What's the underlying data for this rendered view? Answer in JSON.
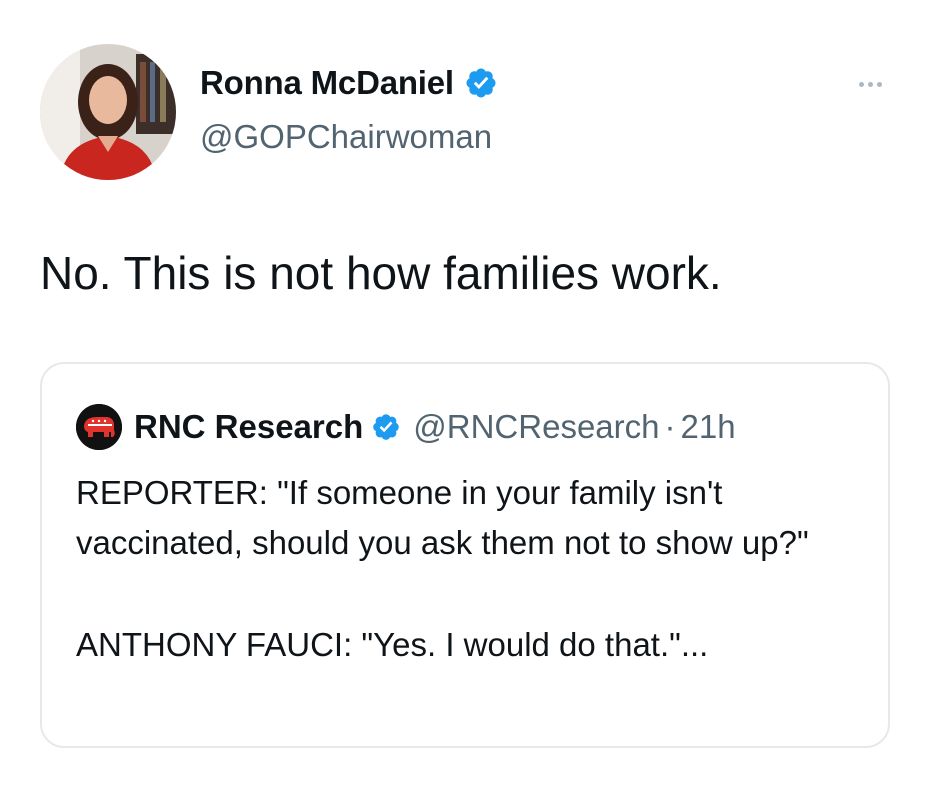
{
  "author": {
    "display_name": "Ronna McDaniel",
    "handle": "@GOPChairwoman",
    "verified": true
  },
  "tweet": {
    "text": "No. This is not how families work."
  },
  "quoted_tweet": {
    "display_name": "RNC Research",
    "handle": "@RNCResearch",
    "separator": "·",
    "time": "21h",
    "verified": true,
    "paragraphs": [
      "REPORTER: \"If someone in your family isn't vaccinated, should you ask them not to show up?\"",
      "ANTHONY FAUCI: \"Yes. I would do that.\"..."
    ]
  },
  "colors": {
    "verified_blue": "#1d9bf0",
    "secondary_text": "#536471",
    "card_border": "#e6e9ec"
  },
  "icons": {
    "more": "more-horizontal-icon",
    "verified": "verified-badge-icon"
  }
}
